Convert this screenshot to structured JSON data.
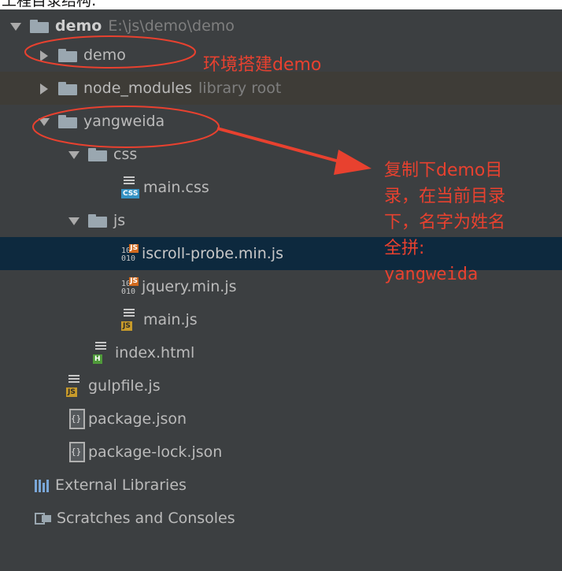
{
  "page_header_text": "工程目录结构:",
  "tree": {
    "project": {
      "name": "demo",
      "path": "E:\\js\\demo\\demo"
    },
    "items": [
      {
        "label": "demo",
        "suffix": ""
      },
      {
        "label": "node_modules",
        "suffix": "library root"
      },
      {
        "label": "yangweida",
        "suffix": ""
      },
      {
        "label": "css",
        "suffix": ""
      },
      {
        "label": "main.css",
        "suffix": ""
      },
      {
        "label": "js",
        "suffix": ""
      },
      {
        "label": "iscroll-probe.min.js",
        "suffix": ""
      },
      {
        "label": "jquery.min.js",
        "suffix": ""
      },
      {
        "label": "main.js",
        "suffix": ""
      },
      {
        "label": "index.html",
        "suffix": ""
      },
      {
        "label": "gulpfile.js",
        "suffix": ""
      },
      {
        "label": "package.json",
        "suffix": ""
      },
      {
        "label": "package-lock.json",
        "suffix": ""
      }
    ],
    "external_libraries": "External Libraries",
    "scratches": "Scratches and Consoles"
  },
  "icon_tags": {
    "css": "CSS",
    "js": "JS",
    "html": "H",
    "bits": "10\n010"
  },
  "annotations": {
    "env_label": "环境搭建demo",
    "note_lines": [
      "复制下demo目",
      "录，在当前目录",
      "下，名字为姓名",
      "全拼:",
      "yangweida"
    ],
    "color": "#e8412f"
  },
  "colors": {
    "panel_bg": "#3c3f41",
    "selected_row": "#0d293e",
    "hover_row": "#3e3c37",
    "text": "#bbbbbb"
  }
}
